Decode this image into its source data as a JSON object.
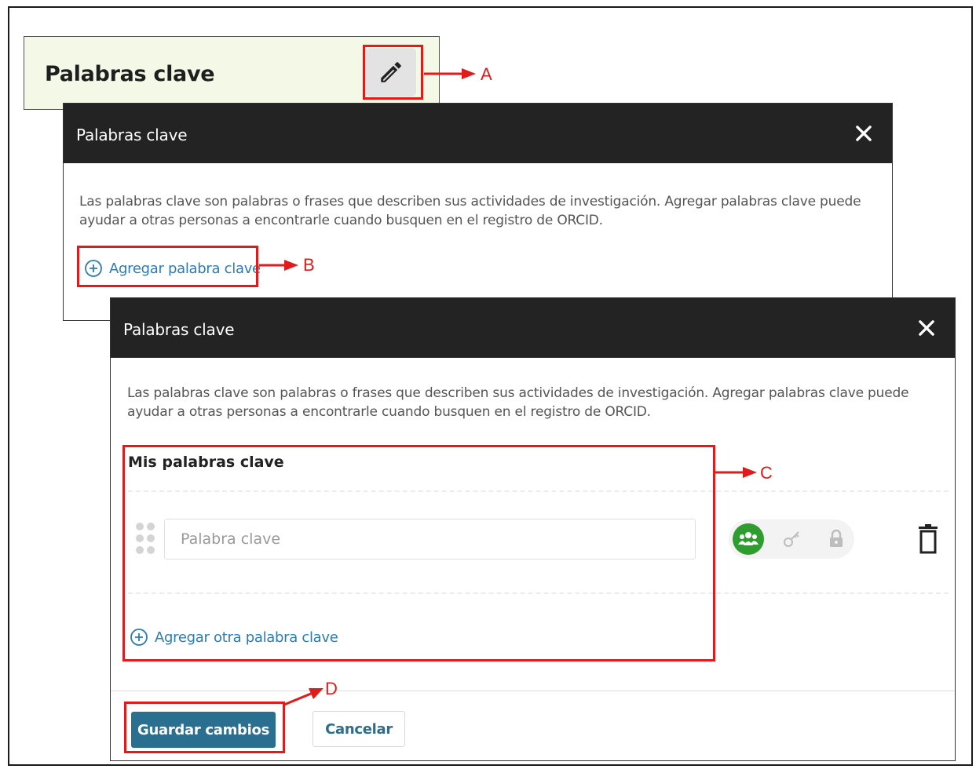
{
  "section": {
    "title": "Palabras clave"
  },
  "dialog_first": {
    "title": "Palabras clave",
    "description": "Las palabras clave son palabras o frases que describen sus actividades de investigación. Agregar palabras clave puede ayudar a otras personas a encontrarle cuando busquen en el registro de ORCID.",
    "add_link": "Agregar palabra clave"
  },
  "dialog_second": {
    "title": "Palabras clave",
    "description": "Las palabras clave son palabras o frases que describen sus actividades de investigación. Agregar palabras clave puede ayudar a otras personas a encontrarle cuando busquen en el registro de ORCID.",
    "section_title": "Mis palabras clave",
    "keyword_input": {
      "value": "",
      "placeholder": "Palabra clave"
    },
    "visibility": {
      "selected": "everyone",
      "options": [
        "everyone",
        "trusted-parties",
        "only-me"
      ]
    },
    "add_another_link": "Agregar otra palabra clave",
    "save_label": "Guardar cambios",
    "cancel_label": "Cancelar"
  },
  "annotations": {
    "a": "A",
    "b": "B",
    "c": "C",
    "d": "D"
  },
  "colors": {
    "header": "#232323",
    "accent": "#2a6f8f",
    "link": "#2b7db1",
    "everyone": "#2e9c2e",
    "annotation": "#e01b1b",
    "section_bg": "#f4f8e6"
  },
  "icons": [
    "pencil-icon",
    "close-icon",
    "plus-circle-icon",
    "drag-handle-icon",
    "everyone-icon",
    "key-icon",
    "lock-icon",
    "trash-icon"
  ]
}
